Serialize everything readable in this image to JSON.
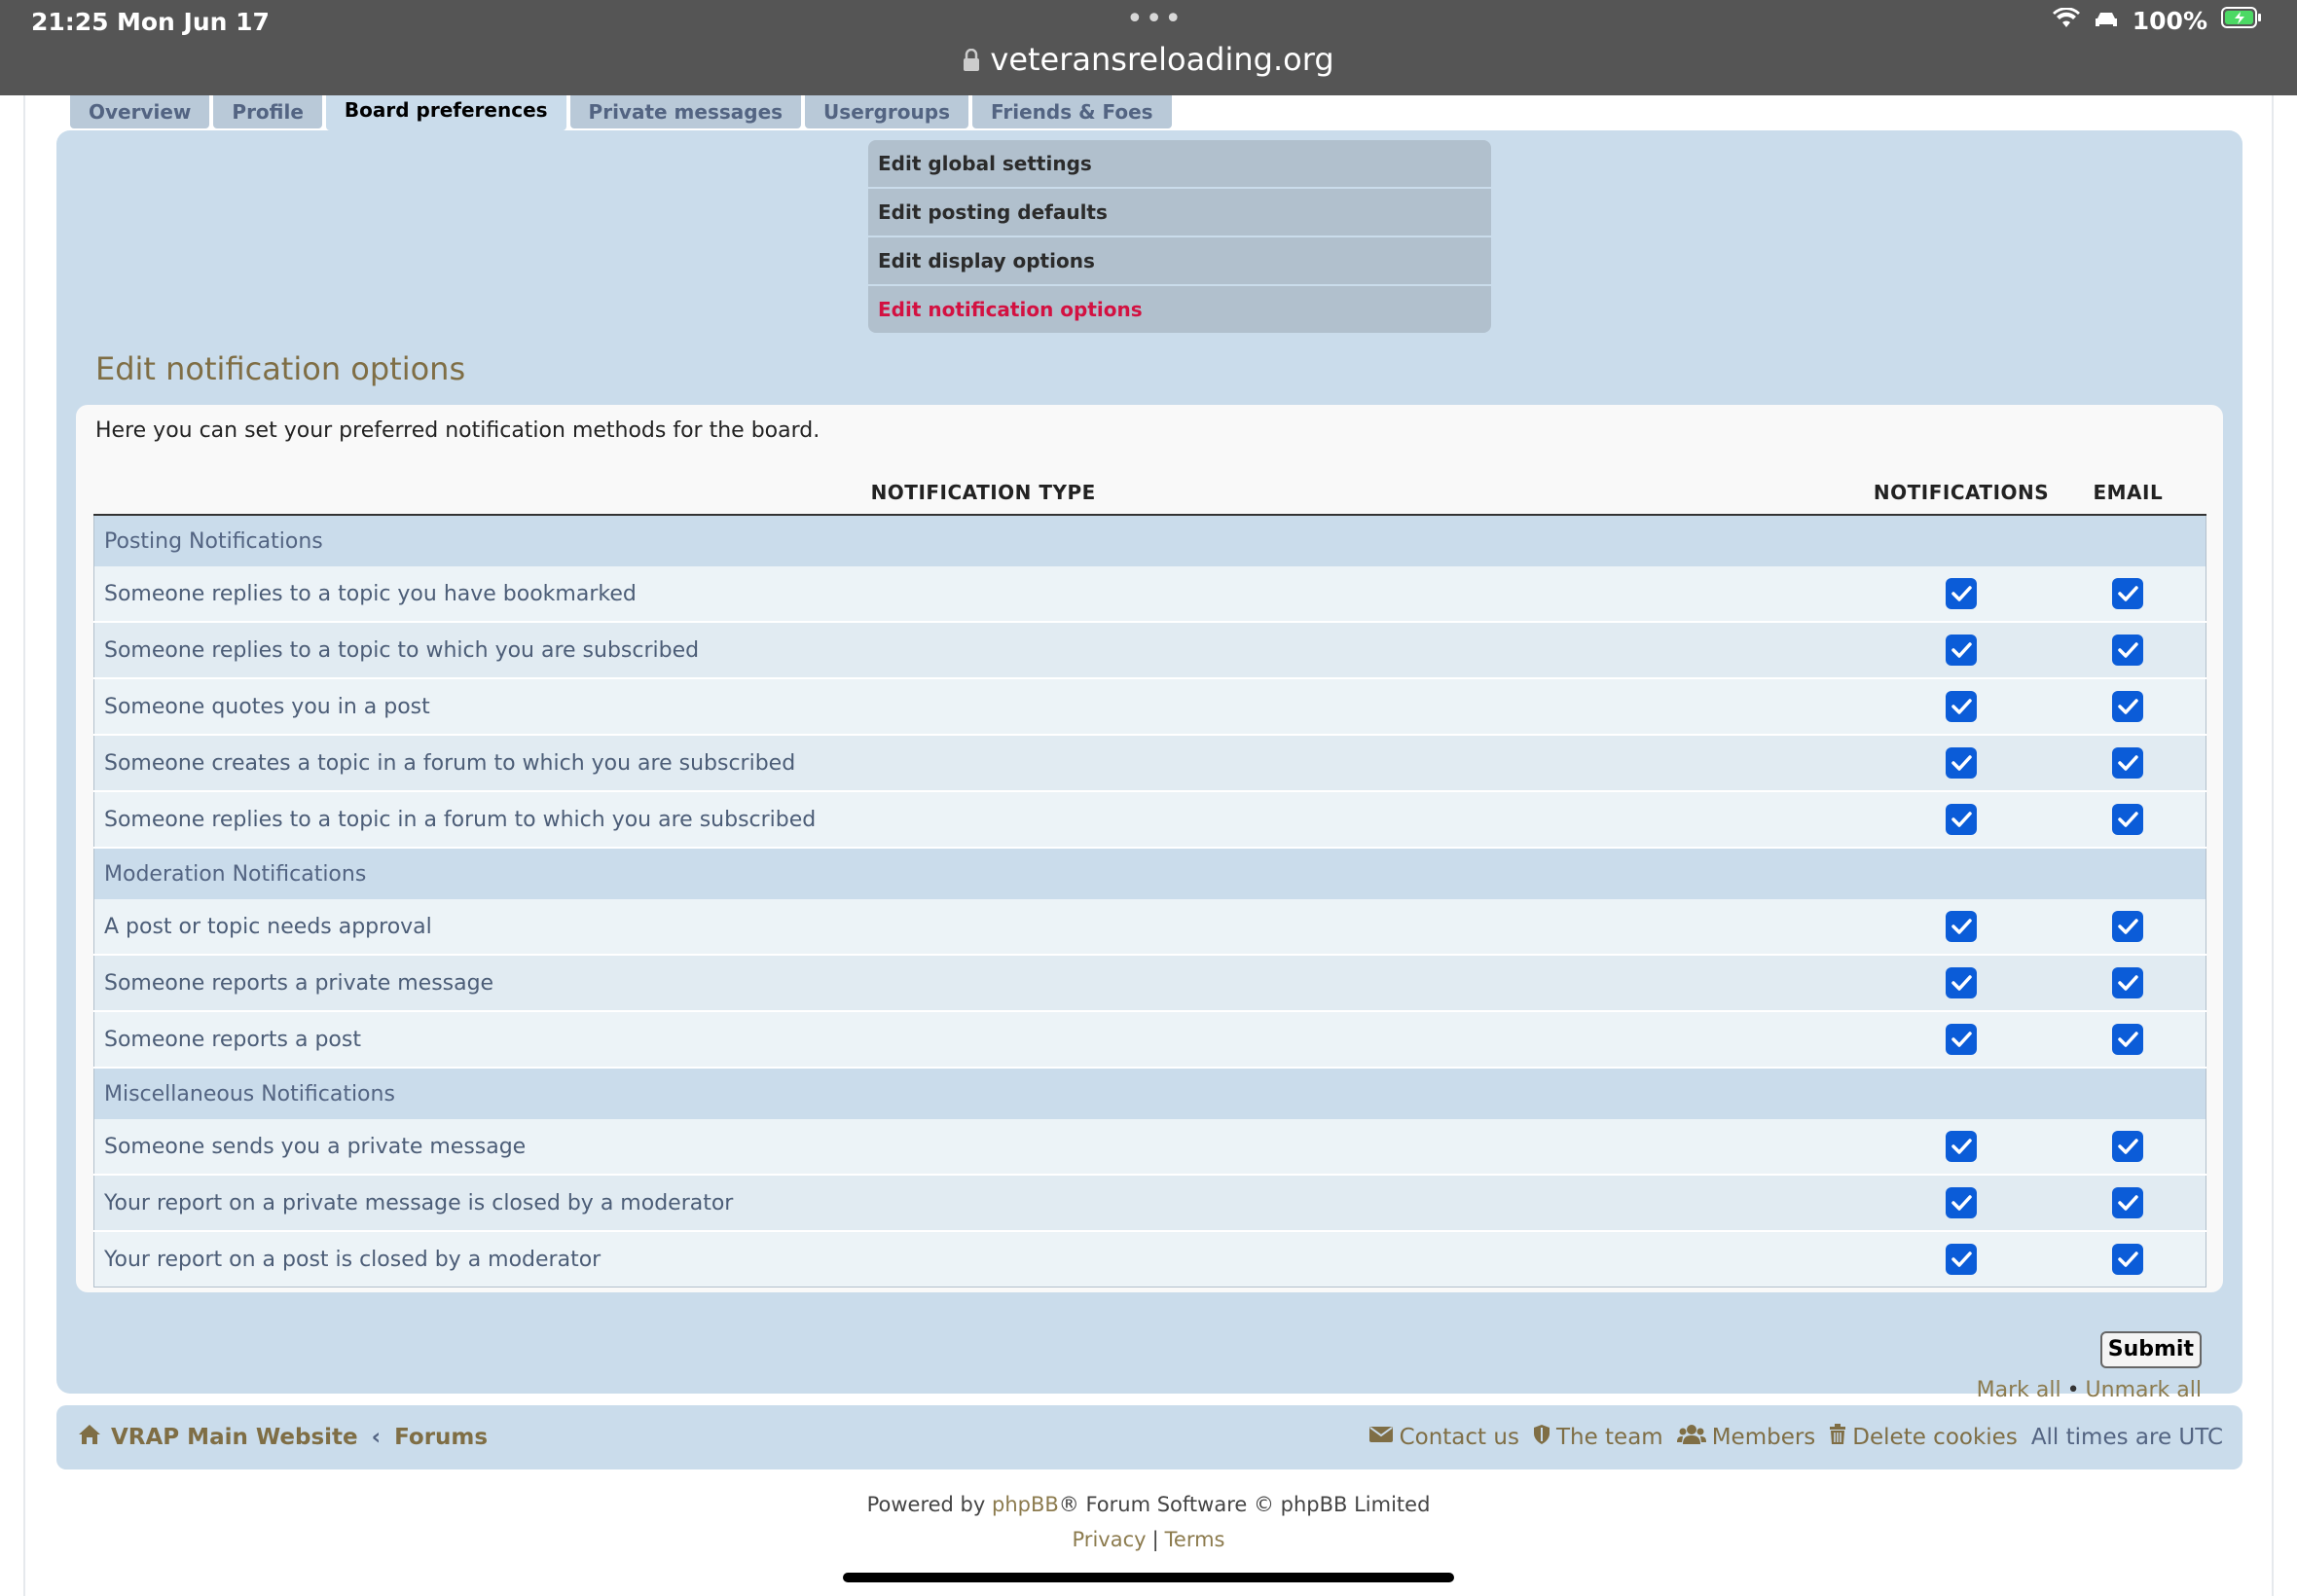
{
  "status_bar": {
    "time": "21:25",
    "date": "Mon Jun 17",
    "battery": "100%",
    "url": "veteransreloading.org"
  },
  "tabs": [
    {
      "label": "Overview"
    },
    {
      "label": "Profile"
    },
    {
      "label": "Board preferences"
    },
    {
      "label": "Private messages"
    },
    {
      "label": "Usergroups"
    },
    {
      "label": "Friends & Foes"
    }
  ],
  "submenu": [
    {
      "label": "Edit global settings"
    },
    {
      "label": "Edit posting defaults"
    },
    {
      "label": "Edit display options"
    },
    {
      "label": "Edit notification options"
    }
  ],
  "section_title": "Edit notification options",
  "intro": "Here you can set your preferred notification methods for the board.",
  "table": {
    "headers": [
      "NOTIFICATION TYPE",
      "NOTIFICATIONS",
      "EMAIL"
    ],
    "groups": [
      {
        "label": "Posting Notifications",
        "rows": [
          {
            "label": "Someone replies to a topic you have bookmarked",
            "notify": true,
            "email": true
          },
          {
            "label": "Someone replies to a topic to which you are subscribed",
            "notify": true,
            "email": true
          },
          {
            "label": "Someone quotes you in a post",
            "notify": true,
            "email": true
          },
          {
            "label": "Someone creates a topic in a forum to which you are subscribed",
            "notify": true,
            "email": true
          },
          {
            "label": "Someone replies to a topic in a forum to which you are subscribed",
            "notify": true,
            "email": true
          }
        ]
      },
      {
        "label": "Moderation Notifications",
        "rows": [
          {
            "label": "A post or topic needs approval",
            "notify": true,
            "email": true
          },
          {
            "label": "Someone reports a private message",
            "notify": true,
            "email": true
          },
          {
            "label": "Someone reports a post",
            "notify": true,
            "email": true
          }
        ]
      },
      {
        "label": "Miscellaneous Notifications",
        "rows": [
          {
            "label": "Someone sends you a private message",
            "notify": true,
            "email": true
          },
          {
            "label": "Your report on a private message is closed by a moderator",
            "notify": true,
            "email": true
          },
          {
            "label": "Your report on a post is closed by a moderator",
            "notify": true,
            "email": true
          }
        ]
      }
    ]
  },
  "submit_label": "Submit",
  "mark_all": "Mark all",
  "mark_sep": "•",
  "unmark_all": "Unmark all",
  "footer_nav": {
    "home": "VRAP Main Website",
    "crumb_sep": "‹",
    "forums": "Forums",
    "contact": "Contact us",
    "team": "The team",
    "members": "Members",
    "delete_cookies": "Delete cookies",
    "timezone": "All times are UTC"
  },
  "copyright": {
    "prefix": "Powered by ",
    "brand": "phpBB",
    "suffix": "® Forum Software © phpBB Limited"
  },
  "legal": {
    "privacy": "Privacy",
    "sep": "|",
    "terms": "Terms"
  },
  "colors": {
    "panel_bg": "#cadceb",
    "tab_bg": "#b9c9d8",
    "accent_red": "#d31141",
    "link_gold": "#8c7b4e",
    "checkbox_blue": "#0b5cd8"
  }
}
